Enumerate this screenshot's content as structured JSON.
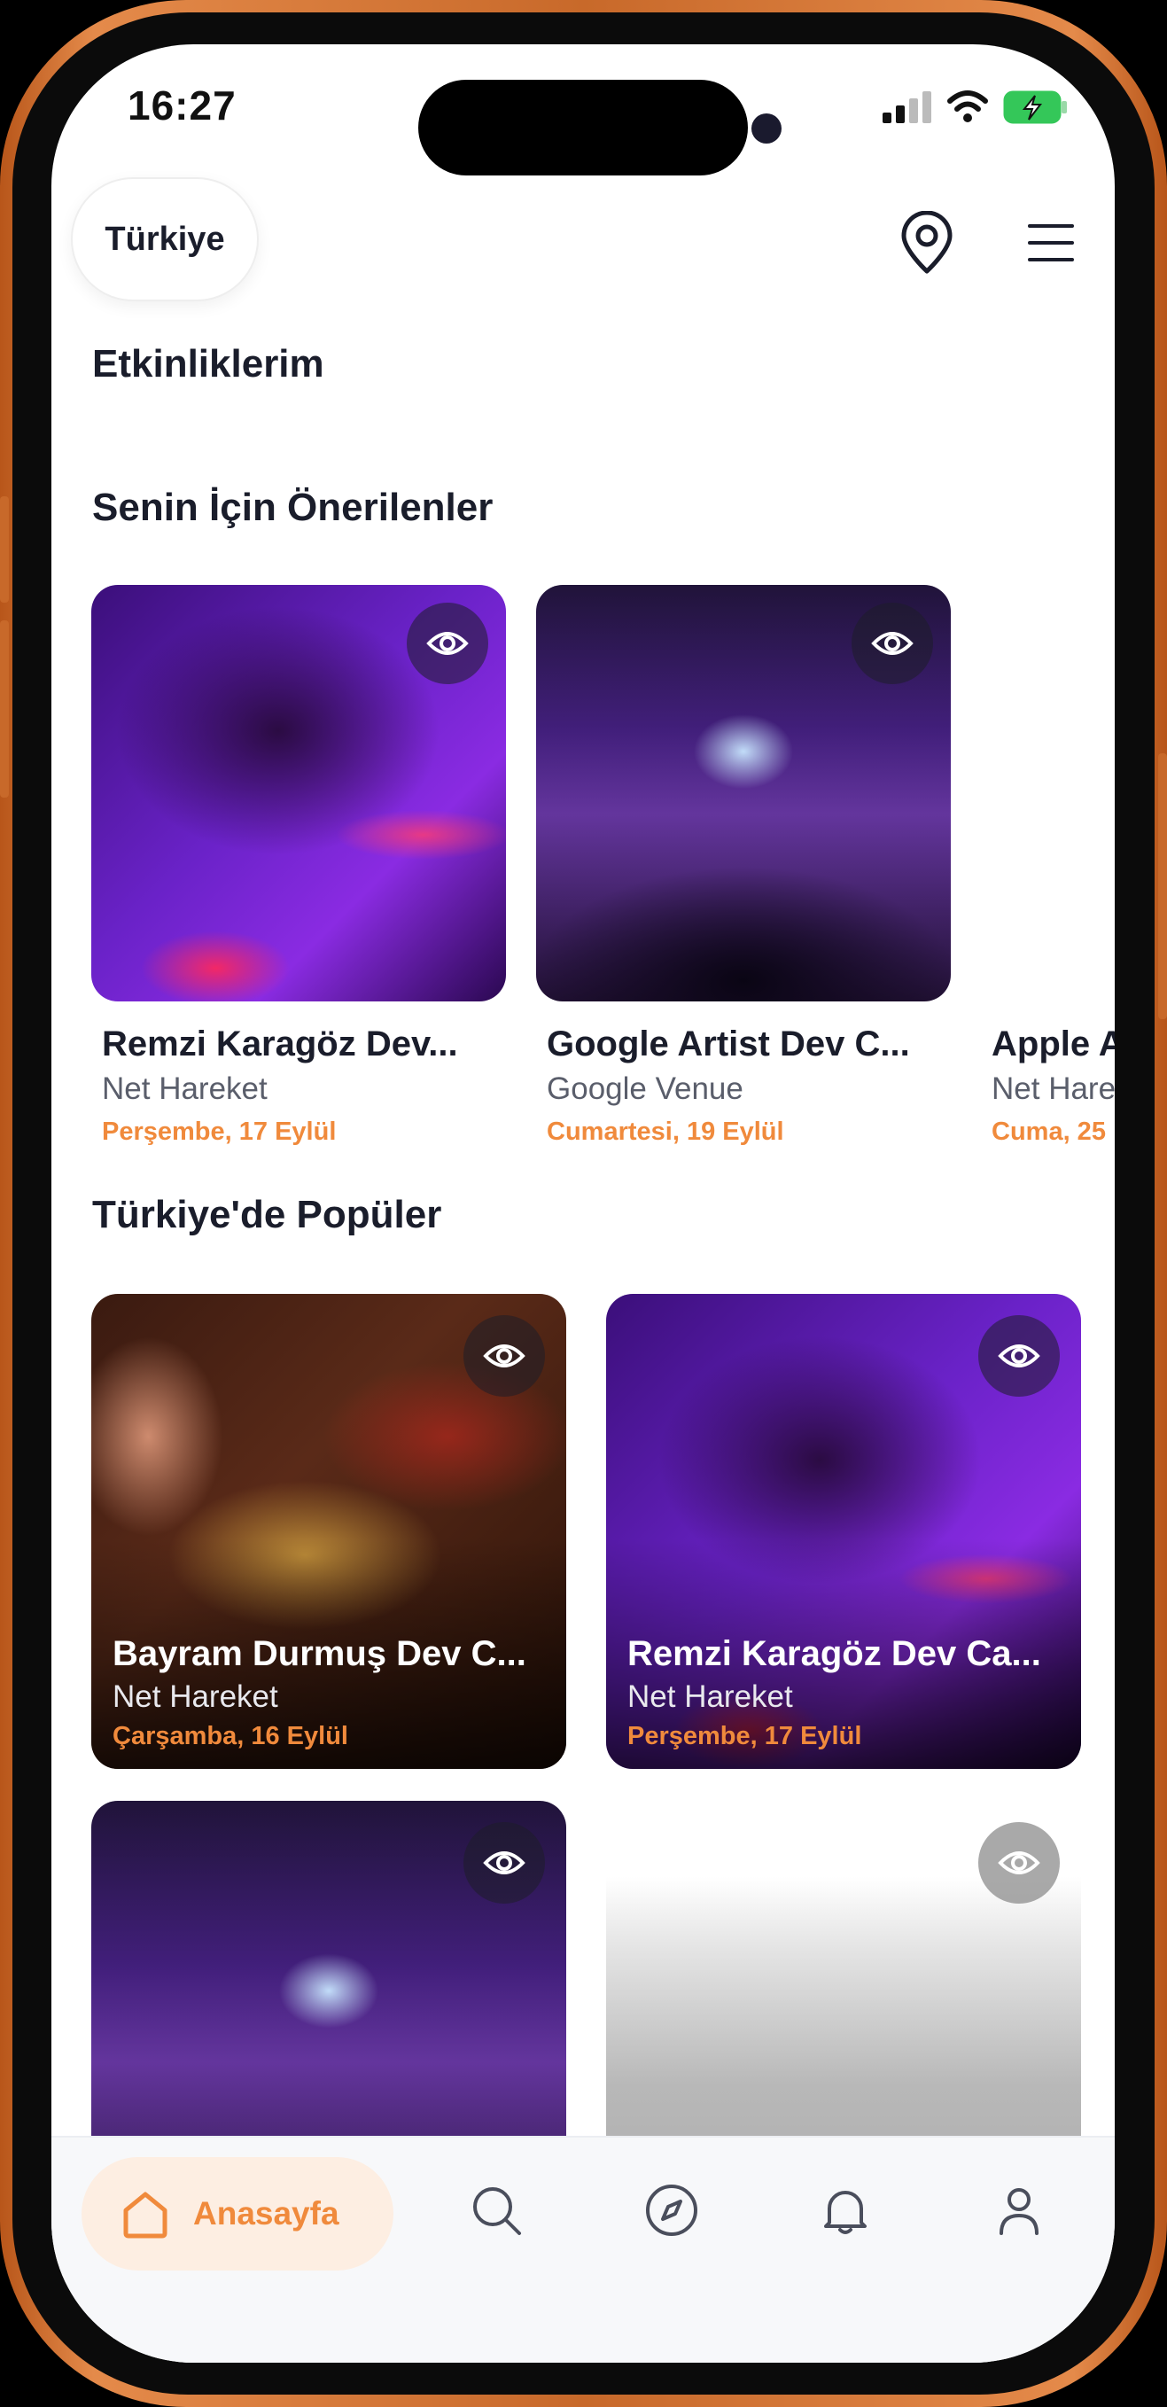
{
  "status_bar": {
    "time": "16:27"
  },
  "header": {
    "country": "Türkiye",
    "location_icon": "location-pin-icon",
    "menu_icon": "hamburger-menu-icon"
  },
  "sections": {
    "my_events": "Etkinliklerim",
    "recommended": "Senin İçin Önerilenler",
    "popular": "Türkiye'de Popüler"
  },
  "recommended": [
    {
      "title": "Remzi Karagöz Dev...",
      "venue": "Net Hareket",
      "date": "Perşembe, 17 Eylül",
      "image": "dj-mixer"
    },
    {
      "title": "Google Artist Dev C...",
      "venue": "Google Venue",
      "date": "Cumartesi, 19 Eylül",
      "image": "concert-crowd"
    },
    {
      "title": "Apple A",
      "venue": "Net Hare",
      "date": "Cuma, 25",
      "image": "none"
    }
  ],
  "popular": [
    {
      "title": "Bayram Durmuş Dev C...",
      "venue": "Net Hareket",
      "date": "Çarşamba, 16 Eylül",
      "image": "trumpet"
    },
    {
      "title": "Remzi Karagöz Dev Ca...",
      "venue": "Net Hareket",
      "date": "Perşembe, 17 Eylül",
      "image": "dj-mixer"
    },
    {
      "title": "",
      "venue": "",
      "date": "",
      "image": "concert-crowd"
    },
    {
      "title": "",
      "venue": "",
      "date": "",
      "image": "blank"
    }
  ],
  "tabbar": {
    "home_label": "Anasayfa",
    "icons": [
      "home-icon",
      "search-icon",
      "compass-icon",
      "bell-icon",
      "profile-icon"
    ]
  },
  "colors": {
    "accent": "#f08a3c",
    "accent_bg": "#fdeee2",
    "text": "#1a1d2b",
    "frame": "#c8692a"
  }
}
